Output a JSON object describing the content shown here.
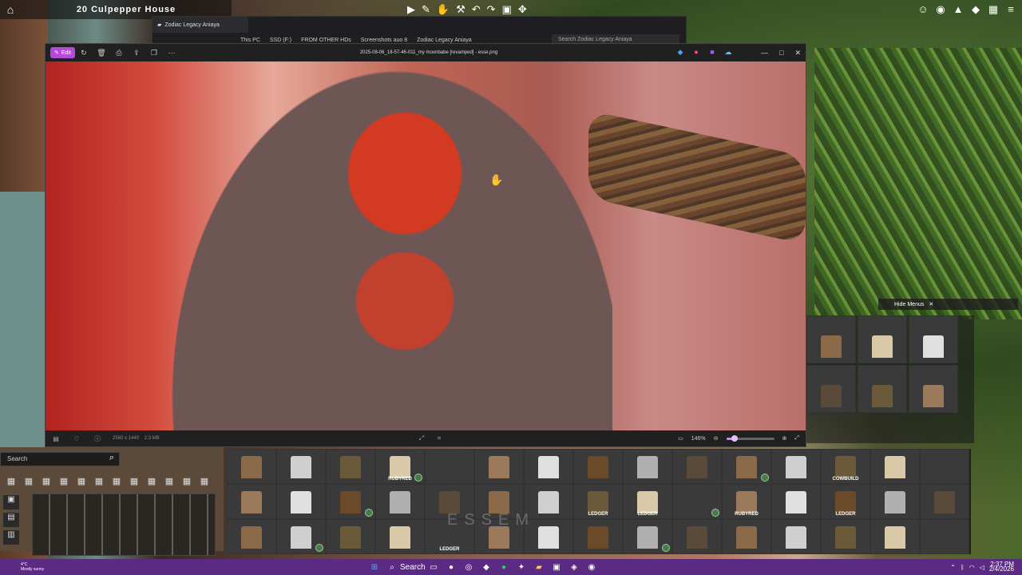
{
  "game": {
    "house_name": "20 Culpepper House",
    "search_placeholder": "Search",
    "hide_menus_label": "Hide Menus",
    "watermark": "ESSEM"
  },
  "explorer": {
    "tab_title": "Zodiac Legacy Aniaya",
    "breadcrumb": [
      "This PC",
      "SSD (F:)",
      "FROM OTHER HDs",
      "Screenshots auo 8",
      "Zodiac Legacy Aniaya"
    ],
    "search_placeholder": "Search Zodiac Legacy Aniaya"
  },
  "viewer": {
    "edit_label": "Edit",
    "title": "2025-08-06_18-57-46-011_my moonbabe [revamped] - esse.png",
    "dimensions": "2560 x 1440",
    "file_size": "2.3 MB",
    "zoom": "146%",
    "zoom_fraction": 0.18
  },
  "catalog": {
    "tags": [
      "",
      "",
      "",
      "RUBYRED",
      "",
      "",
      "",
      "",
      "",
      "",
      "",
      "",
      "COWBUILD",
      "",
      "",
      "",
      "",
      "",
      "",
      "",
      "",
      "",
      "LEDGER",
      "LEDGER",
      "",
      "RUBYRED",
      "",
      "LEDGER",
      "",
      "",
      "",
      "",
      "",
      "",
      "LEDGER",
      "",
      "",
      "",
      "",
      "",
      "",
      "",
      "",
      "",
      ""
    ]
  },
  "taskbar": {
    "temperature": "4°C",
    "weather": "Mostly sunny",
    "search_label": "Search",
    "time": "2:37 PM",
    "date": "2/4/2026"
  }
}
